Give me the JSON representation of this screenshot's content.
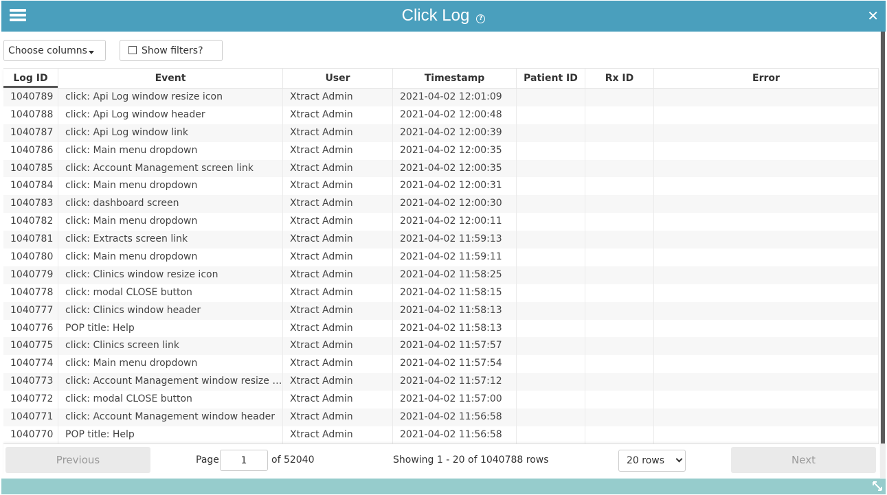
{
  "window": {
    "title": "Click Log",
    "help_glyph": "?",
    "close_glyph": "✕"
  },
  "toolbar": {
    "choose_columns": "Choose columns",
    "show_filters": "Show filters?"
  },
  "columns": [
    "Log ID",
    "Event",
    "User",
    "Timestamp",
    "Patient ID",
    "Rx ID",
    "Error"
  ],
  "rows": [
    [
      "1040789",
      "click: Api Log window resize icon",
      "Xtract Admin",
      "2021-04-02 12:01:09",
      "",
      "",
      ""
    ],
    [
      "1040788",
      "click: Api Log window header",
      "Xtract Admin",
      "2021-04-02 12:00:48",
      "",
      "",
      ""
    ],
    [
      "1040787",
      "click: Api Log window link",
      "Xtract Admin",
      "2021-04-02 12:00:39",
      "",
      "",
      ""
    ],
    [
      "1040786",
      "click: Main menu dropdown",
      "Xtract Admin",
      "2021-04-02 12:00:35",
      "",
      "",
      ""
    ],
    [
      "1040785",
      "click: Account Management screen link",
      "Xtract Admin",
      "2021-04-02 12:00:35",
      "",
      "",
      ""
    ],
    [
      "1040784",
      "click: Main menu dropdown",
      "Xtract Admin",
      "2021-04-02 12:00:31",
      "",
      "",
      ""
    ],
    [
      "1040783",
      "click: dashboard screen",
      "Xtract Admin",
      "2021-04-02 12:00:30",
      "",
      "",
      ""
    ],
    [
      "1040782",
      "click: Main menu dropdown",
      "Xtract Admin",
      "2021-04-02 12:00:11",
      "",
      "",
      ""
    ],
    [
      "1040781",
      "click: Extracts screen link",
      "Xtract Admin",
      "2021-04-02 11:59:13",
      "",
      "",
      ""
    ],
    [
      "1040780",
      "click: Main menu dropdown",
      "Xtract Admin",
      "2021-04-02 11:59:11",
      "",
      "",
      ""
    ],
    [
      "1040779",
      "click: Clinics window resize icon",
      "Xtract Admin",
      "2021-04-02 11:58:25",
      "",
      "",
      ""
    ],
    [
      "1040778",
      "click: modal CLOSE button",
      "Xtract Admin",
      "2021-04-02 11:58:15",
      "",
      "",
      ""
    ],
    [
      "1040777",
      "click: Clinics window header",
      "Xtract Admin",
      "2021-04-02 11:58:13",
      "",
      "",
      ""
    ],
    [
      "1040776",
      "POP title: Help",
      "Xtract Admin",
      "2021-04-02 11:58:13",
      "",
      "",
      ""
    ],
    [
      "1040775",
      "click: Clinics screen link",
      "Xtract Admin",
      "2021-04-02 11:57:57",
      "",
      "",
      ""
    ],
    [
      "1040774",
      "click: Main menu dropdown",
      "Xtract Admin",
      "2021-04-02 11:57:54",
      "",
      "",
      ""
    ],
    [
      "1040773",
      "click: Account Management window resize ic...",
      "Xtract Admin",
      "2021-04-02 11:57:12",
      "",
      "",
      ""
    ],
    [
      "1040772",
      "click: modal CLOSE button",
      "Xtract Admin",
      "2021-04-02 11:57:00",
      "",
      "",
      ""
    ],
    [
      "1040771",
      "click: Account Management window header",
      "Xtract Admin",
      "2021-04-02 11:56:58",
      "",
      "",
      ""
    ],
    [
      "1040770",
      "POP title: Help",
      "Xtract Admin",
      "2021-04-02 11:56:58",
      "",
      "",
      ""
    ]
  ],
  "pager": {
    "previous": "Previous",
    "page_label": "Page",
    "page_value": "1",
    "of_label": "of 52040",
    "showing": "Showing 1 - 20 of 1040788 rows",
    "rows_select": "20 rows",
    "next": "Next"
  }
}
